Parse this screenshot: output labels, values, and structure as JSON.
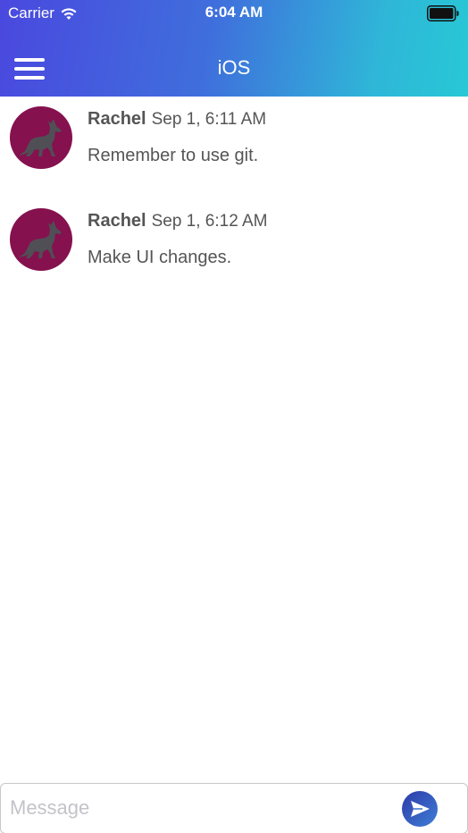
{
  "status_bar": {
    "carrier": "Carrier",
    "time": "6:04 AM",
    "wifi_icon": "wifi-icon",
    "battery_icon": "battery-icon"
  },
  "nav": {
    "title": "iOS",
    "menu_icon": "hamburger-menu-icon"
  },
  "colors": {
    "header_gradient_start": "#4a48df",
    "header_gradient_end": "#27c8d6",
    "avatar_background": "#85114f",
    "send_button": "#3f7fd6"
  },
  "messages": [
    {
      "author": "Rachel",
      "time": "Sep 1, 6:11 AM",
      "text": "Remember to use git.",
      "avatar_icon": "fox-avatar-icon"
    },
    {
      "author": "Rachel",
      "time": "Sep 1, 6:12 AM",
      "text": "Make UI changes.",
      "avatar_icon": "fox-avatar-icon"
    }
  ],
  "composer": {
    "placeholder": "Message",
    "value": "",
    "send_icon": "send-icon"
  }
}
